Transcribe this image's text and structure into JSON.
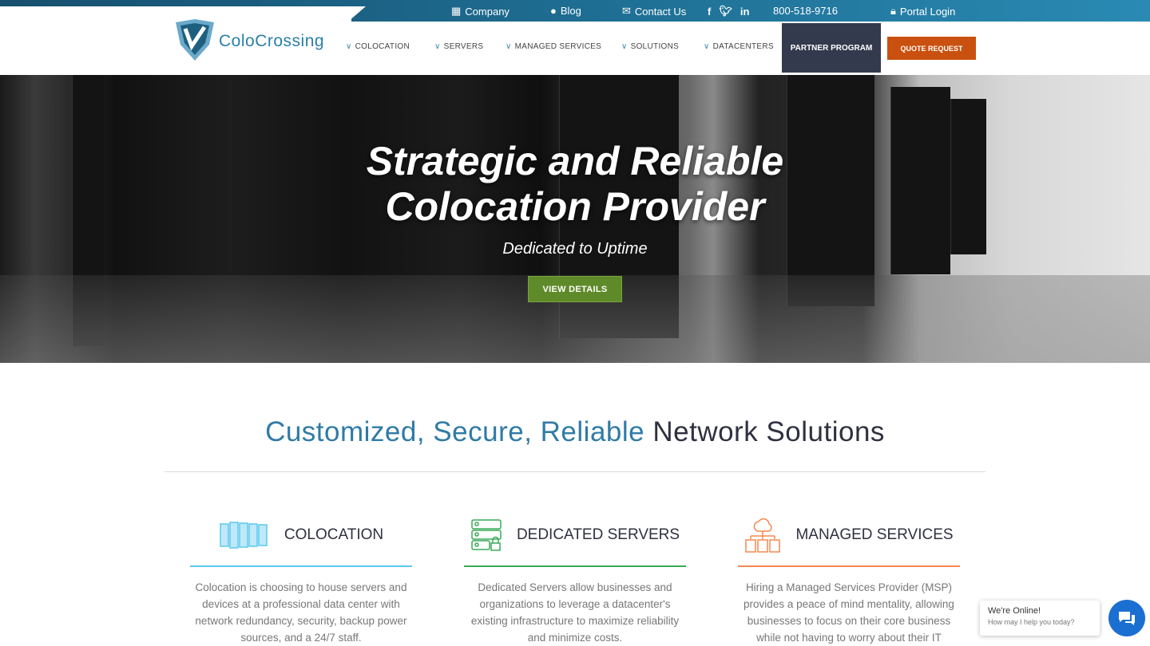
{
  "topbar": {
    "company": "Company",
    "blog": "Blog",
    "contact": "Contact Us",
    "phone": "800-518-9716",
    "portal": "Portal Login",
    "social": [
      "facebook-icon",
      "twitter-icon",
      "linkedin-icon"
    ]
  },
  "logo": {
    "text": "ColoCrossing"
  },
  "nav": {
    "items": [
      "COLOCATION",
      "SERVERS",
      "MANAGED SERVICES",
      "SOLUTIONS",
      "DATACENTERS"
    ],
    "partner": "PARTNER PROGRAM",
    "quote": "QUOTE REQUEST"
  },
  "hero": {
    "title_line1": "Strategic and Reliable",
    "title_line2": "Colocation Provider",
    "subtitle": "Dedicated to Uptime",
    "button": "VIEW DETAILS"
  },
  "section": {
    "title_accent": "Customized, Secure, Reliable",
    "title_rest": " Network Solutions"
  },
  "services": [
    {
      "title": "COLOCATION",
      "color": "#5cc8ef",
      "text": "Colocation is choosing to house servers and devices at a professional data center with network redundancy, security, backup power sources, and a 24/7 staff."
    },
    {
      "title": "DEDICATED SERVERS",
      "color": "#3aaa5a",
      "text": "Dedicated Servers allow businesses and organizations to leverage a datacenter's existing infrastructure to maximize reliability and minimize costs."
    },
    {
      "title": "MANAGED SERVICES",
      "color": "#f5894f",
      "text": "Hiring a Managed Services Provider (MSP) provides a peace of mind mentality, allowing businesses to focus on their core business while not having to worry about their IT"
    }
  ],
  "chat": {
    "status": "We're Online!",
    "prompt": "How may I help you today?"
  },
  "colors": {
    "accent": "#2f7ba6",
    "partner_bg": "#343a4d",
    "quote_bg": "#c9500f",
    "hero_button": "#5f8a2a"
  }
}
